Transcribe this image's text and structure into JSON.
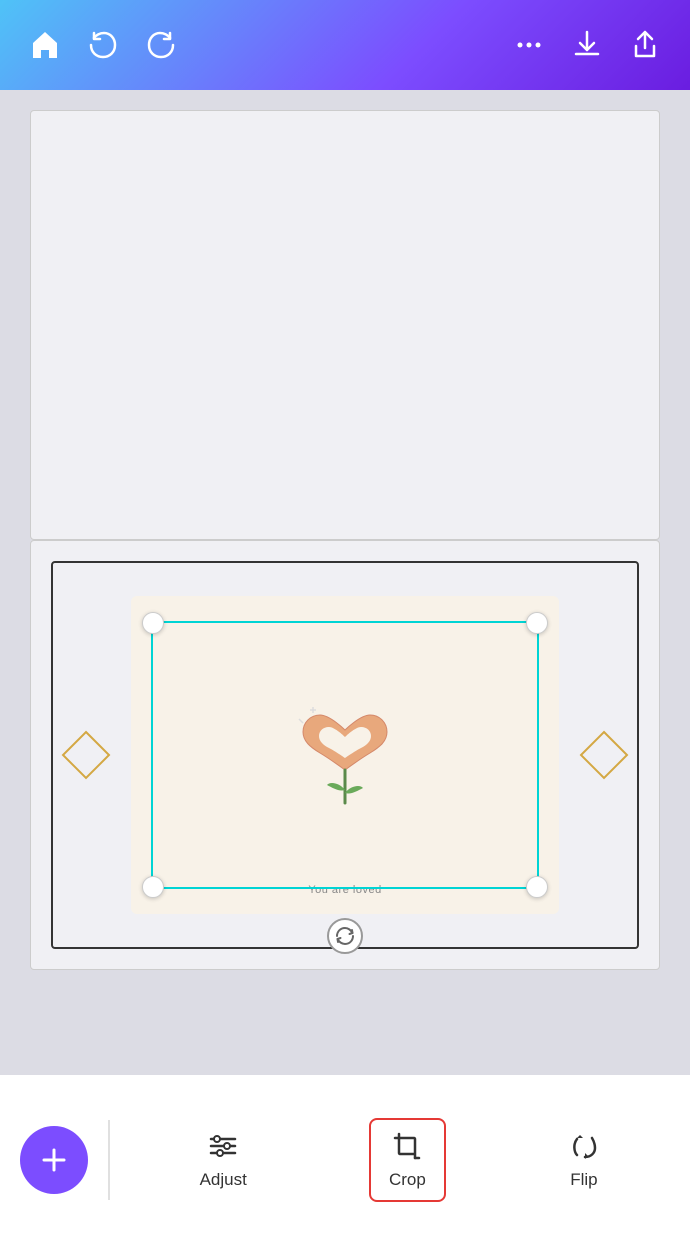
{
  "header": {
    "home_label": "Home",
    "undo_label": "Undo",
    "redo_label": "Redo",
    "more_label": "More options",
    "download_label": "Download",
    "share_label": "Share"
  },
  "canvas": {
    "card_text": "You are loved"
  },
  "toolbar": {
    "add_label": "+",
    "adjust_label": "Adjust",
    "crop_label": "Crop",
    "flip_label": "Flip"
  },
  "colors": {
    "header_gradient_start": "#4fc3f7",
    "header_gradient_end": "#7c4dff",
    "crop_border": "#00d4d4",
    "active_border": "#e53935",
    "add_button_bg": "#7c4dff"
  }
}
